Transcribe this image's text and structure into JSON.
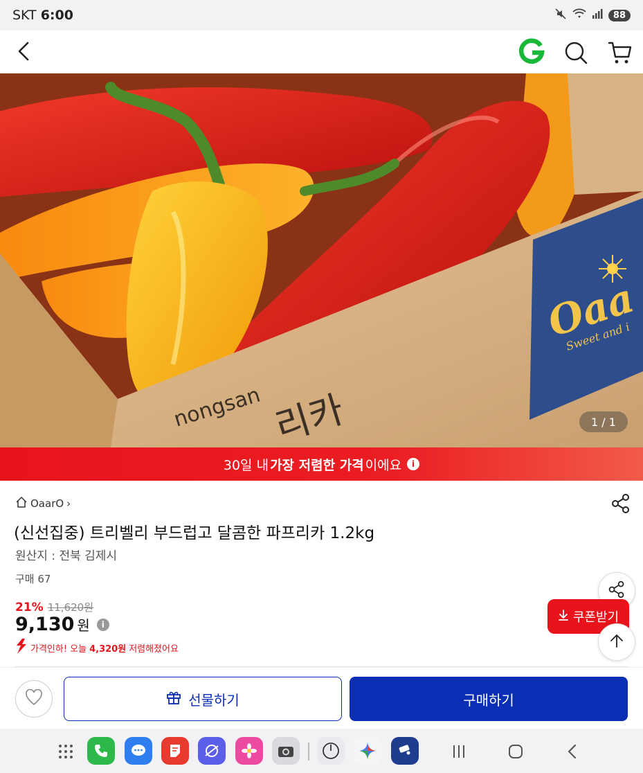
{
  "status_bar": {
    "carrier": "SKT",
    "time": "6:00",
    "battery": "88"
  },
  "app_bar": {
    "logo_letter": "G"
  },
  "hero": {
    "box_brand": "nongsan",
    "box_text": "리카",
    "logo_text": "Oaa",
    "logo_sub": "Sweet and i",
    "page_counter": "1 / 1"
  },
  "banner": {
    "prefix": "30일 내 ",
    "highlight": "가장 저렴한 가격",
    "suffix": "이에요",
    "info_glyph": "i"
  },
  "product": {
    "store_name": "OaarO",
    "store_chevron": "›",
    "title": "(신선집중) 트리벨리 부드럽고 달콤한 파프리카 1.2kg",
    "origin": "원산지 : 전북 김제시",
    "sold": "구매 67",
    "discount": "21%",
    "original_price": "11,620원",
    "price": "9,130",
    "currency": "원",
    "price_info": "i",
    "drop_prefix": "가격인하! 오늘 ",
    "drop_amount": "4,320원",
    "drop_suffix": " 저렴해졌어요"
  },
  "coupon": {
    "label": "쿠폰받기"
  },
  "actions": {
    "gift_label": "선물하기",
    "buy_label": "구매하기"
  },
  "colors": {
    "accent_red": "#e8141c",
    "brand_blue": "#0a2eb4",
    "g_green": "#19b839"
  }
}
